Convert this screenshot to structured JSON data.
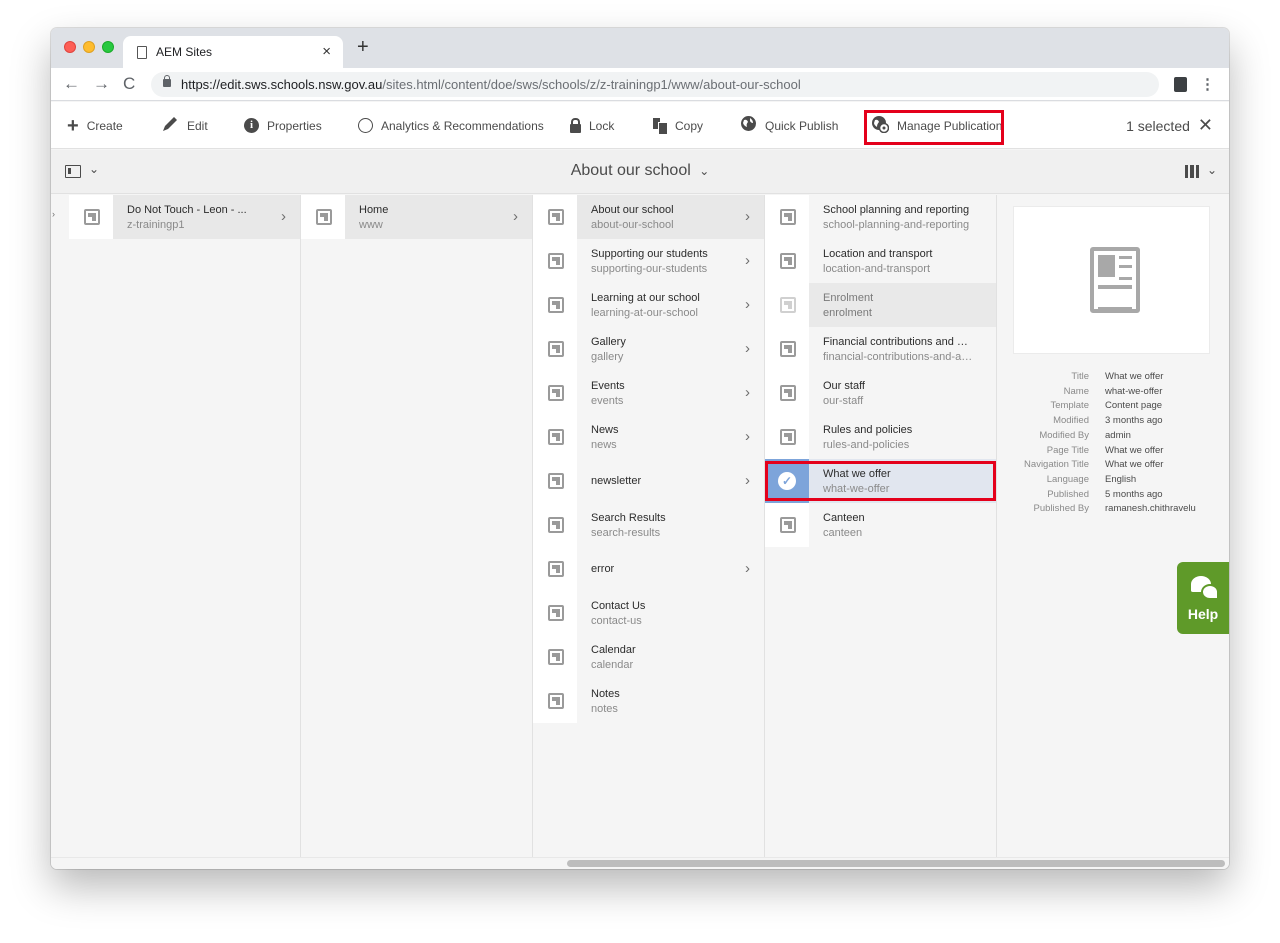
{
  "browser": {
    "tab_title": "AEM Sites",
    "tab_close": "×",
    "new_tab": "+",
    "url_host": "https://edit.sws.schools.nsw.gov.au",
    "url_path": "/sites.html/content/doe/sws/schools/z/z-trainingp1/www/about-our-school",
    "back": "←",
    "forward": "→",
    "reload": "C",
    "menu": "⋮"
  },
  "actionbar": {
    "create": "Create",
    "edit": "Edit",
    "properties": "Properties",
    "analytics": "Analytics & Recommendations",
    "lock": "Lock",
    "copy": "Copy",
    "quick_publish": "Quick Publish",
    "manage_publication": "Manage Publication",
    "selected_count": "1 selected",
    "close": "✕"
  },
  "titlebar": {
    "page_title": "About our school",
    "chevron": "⌄"
  },
  "columns": [
    {
      "items": [
        {
          "title": "Do Not Touch - Leon - ...",
          "name": "z-trainingp1",
          "chevron": true,
          "state": "active"
        }
      ]
    },
    {
      "items": [
        {
          "title": "Home",
          "name": "www",
          "chevron": true,
          "state": "active"
        }
      ]
    },
    {
      "items": [
        {
          "title": "About our school",
          "name": "about-our-school",
          "chevron": true,
          "state": "active"
        },
        {
          "title": "Supporting our students",
          "name": "supporting-our-students",
          "chevron": true
        },
        {
          "title": "Learning at our school",
          "name": "learning-at-our-school",
          "chevron": true
        },
        {
          "title": "Gallery",
          "name": "gallery",
          "chevron": true
        },
        {
          "title": "Events",
          "name": "events",
          "chevron": true
        },
        {
          "title": "News",
          "name": "news",
          "chevron": true
        },
        {
          "title": "newsletter",
          "name": "",
          "chevron": true
        },
        {
          "title": "Search Results",
          "name": "search-results",
          "chevron": false
        },
        {
          "title": "error",
          "name": "",
          "chevron": true
        },
        {
          "title": "Contact Us",
          "name": "contact-us",
          "chevron": false
        },
        {
          "title": "Calendar",
          "name": "calendar",
          "chevron": false
        },
        {
          "title": "Notes",
          "name": "notes",
          "chevron": false
        }
      ]
    },
    {
      "items": [
        {
          "title": "School planning and reporting",
          "name": "school-planning-and-reporting",
          "chevron": false
        },
        {
          "title": "Location and transport",
          "name": "location-and-transport",
          "chevron": false
        },
        {
          "title": "Enrolment",
          "name": "enrolment",
          "chevron": false,
          "state": "dim"
        },
        {
          "title": "Financial contributions and as...",
          "name": "financial-contributions-and-as...",
          "chevron": false
        },
        {
          "title": "Our staff",
          "name": "our-staff",
          "chevron": false
        },
        {
          "title": "Rules and policies",
          "name": "rules-and-policies",
          "chevron": false
        },
        {
          "title": "What we offer",
          "name": "what-we-offer",
          "chevron": false,
          "state": "selected"
        },
        {
          "title": "Canteen",
          "name": "canteen",
          "chevron": false
        }
      ]
    }
  ],
  "meta": [
    {
      "key": "Title",
      "value": "What we offer"
    },
    {
      "key": "Name",
      "value": "what-we-offer"
    },
    {
      "key": "Template",
      "value": "Content page"
    },
    {
      "key": "Modified",
      "value": "3 months ago"
    },
    {
      "key": "Modified By",
      "value": "admin"
    },
    {
      "key": "Page Title",
      "value": "What we offer"
    },
    {
      "key": "Navigation Title",
      "value": "What we offer"
    },
    {
      "key": "Language",
      "value": "English"
    },
    {
      "key": "Published",
      "value": "5 months ago"
    },
    {
      "key": "Published By",
      "value": "ramanesh.chithravelu"
    }
  ],
  "help": {
    "label": "Help"
  },
  "icons": {
    "create": "plus-icon",
    "edit": "pencil-icon",
    "properties": "info-icon",
    "analytics": "analytics-icon",
    "lock": "lock-icon",
    "copy": "copy-icon",
    "quick_publish": "globe-icon",
    "manage_publication": "globe-gear-icon"
  },
  "colors": {
    "highlight": "#e4001b",
    "selected_thumb": "#7da4da",
    "help": "#5f9a29"
  }
}
